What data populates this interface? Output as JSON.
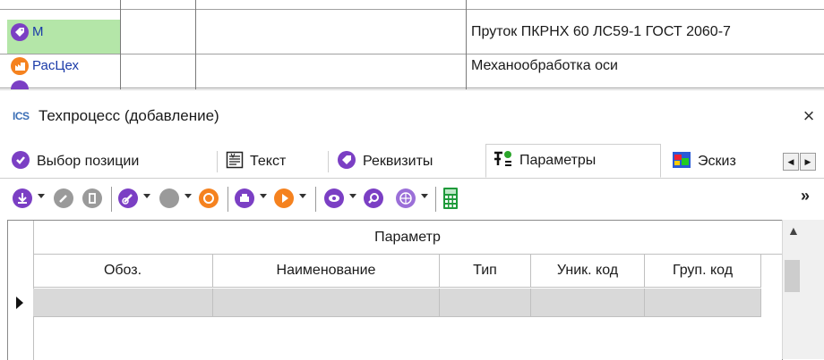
{
  "background": {
    "rows": [
      {
        "code": "М",
        "icon": "tag-icon",
        "description": "Пруток ПКРНХ 60 ЛС59-1 ГОСТ 2060-7"
      },
      {
        "code": "РасЦех",
        "icon": "workshop-icon",
        "description": "Механообработка оси"
      }
    ]
  },
  "dialog": {
    "logo": "ICS",
    "title": "Техпроцесс (добавление)",
    "close": "×",
    "tabs": [
      {
        "label": "Выбор позиции",
        "icon": "select-position-icon"
      },
      {
        "label": "Текст",
        "icon": "text-doc-icon"
      },
      {
        "label": "Реквизиты",
        "icon": "tag-icon"
      },
      {
        "label": "Параметры",
        "icon": "parameters-icon",
        "active": true
      },
      {
        "label": "Эскиз",
        "icon": "sketch-icon"
      }
    ],
    "more": "»",
    "grid": {
      "group_header": "Параметр",
      "columns": [
        "Обоз.",
        "Наименование",
        "Тип",
        "Уник. код",
        "Груп. код"
      ]
    },
    "colors": {
      "accent": "#7b3fc4",
      "selected_row": "#d9d9d9",
      "green_cell": "#b4e6a8",
      "orange": "#f5821f"
    }
  }
}
